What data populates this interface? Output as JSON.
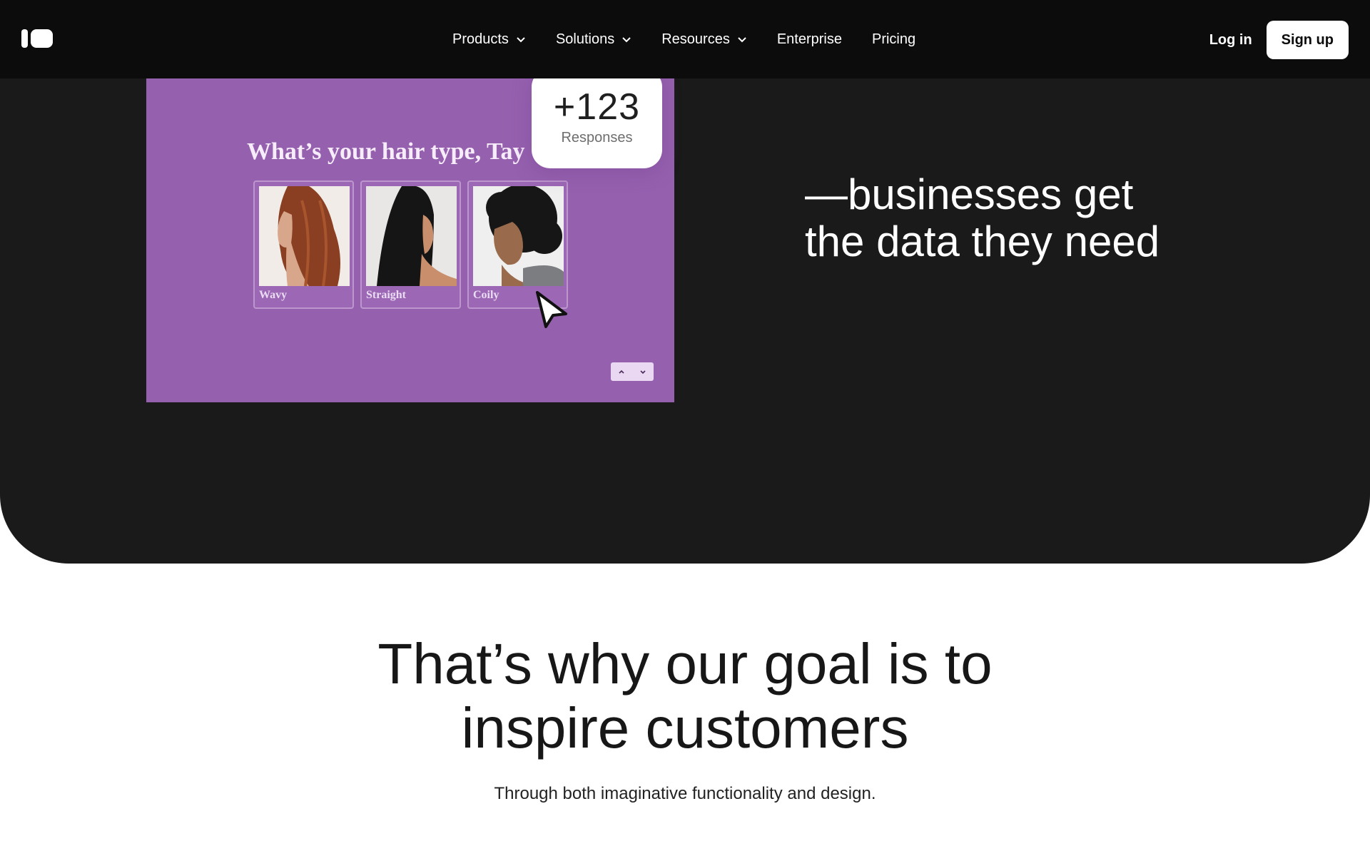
{
  "nav": {
    "logo": "logo-icon",
    "items": [
      {
        "label": "Products",
        "has_dropdown": true
      },
      {
        "label": "Solutions",
        "has_dropdown": true
      },
      {
        "label": "Resources",
        "has_dropdown": true
      },
      {
        "label": "Enterprise",
        "has_dropdown": false
      },
      {
        "label": "Pricing",
        "has_dropdown": false
      }
    ],
    "login_label": "Log in",
    "signup_label": "Sign up"
  },
  "hero": {
    "tagline_line1": "—businesses get",
    "tagline_line2": "the data they need",
    "mock": {
      "question": "What’s your hair type, Tay",
      "options": [
        {
          "label": "Wavy"
        },
        {
          "label": "Straight"
        },
        {
          "label": "Coily"
        }
      ],
      "badge_count": "+123",
      "badge_label": "Responses"
    }
  },
  "section": {
    "heading_line1": "That’s why our goal is to",
    "heading_line2": "inspire customers",
    "subtitle": "Through both imaginative functionality and design."
  },
  "colors": {
    "hero_bg": "#1a1a1a",
    "nav_bg": "#0c0c0c",
    "mock_purple": "#9560ae",
    "text_dark": "#171717"
  }
}
